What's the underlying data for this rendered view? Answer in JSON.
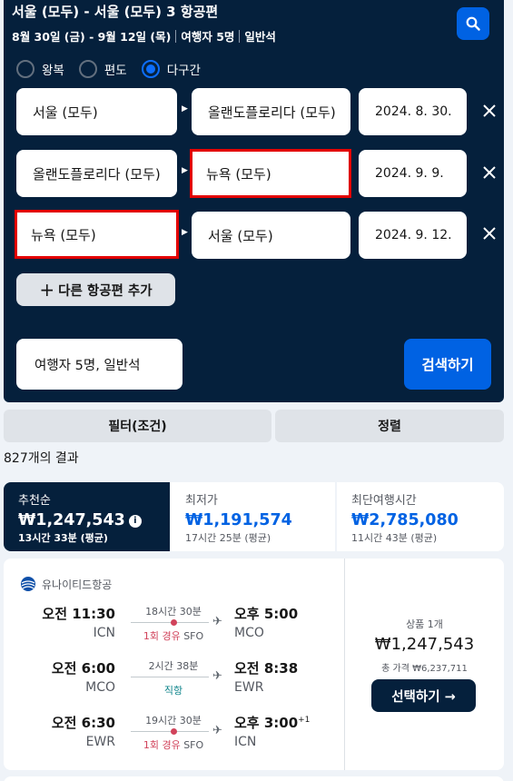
{
  "header": {
    "title": "서울 (모두) - 서울 (모두) 3 항공편",
    "dates": "8월 30일 (금) - 9월 12일 (목)",
    "travelers": "여행자 5명",
    "cabin": "일반석"
  },
  "trip_types": [
    {
      "label": "왕복",
      "selected": false
    },
    {
      "label": "편도",
      "selected": false
    },
    {
      "label": "다구간",
      "selected": true
    }
  ],
  "legs": [
    {
      "from": "서울 (모두)",
      "to": "올랜도플로리다 (모두)",
      "date": "2024. 8. 30."
    },
    {
      "from": "올랜도플로리다 (모두)",
      "to": "뉴욕 (모두)",
      "date": "2024. 9. 9."
    },
    {
      "from": "뉴욕 (모두)",
      "to": "서울 (모두)",
      "date": "2024. 9. 12."
    }
  ],
  "add_flight_label": "다른 항공편 추가",
  "travelers_field": "여행자 5명, 일반석",
  "search_label": "검색하기",
  "filter_label": "필터(조건)",
  "sort_label": "정렬",
  "result_count": "827개의 결과",
  "sort_tabs": [
    {
      "label": "추천순",
      "price": "₩1,247,543",
      "duration": "13시간 33분 (평균)"
    },
    {
      "label": "최저가",
      "price": "₩1,191,574",
      "duration": "17시간 25분 (평균)"
    },
    {
      "label": "최단여행시간",
      "price": "₩2,785,080",
      "duration": "11시간 43분 (평균)"
    }
  ],
  "result": {
    "airline": "유나이티드항공",
    "legs": [
      {
        "dep_time": "오전 11:30",
        "dep_code": "ICN",
        "duration": "18시간 30분",
        "stops": "1회 경유",
        "via": "SFO",
        "arr_time": "오후 5:00",
        "arr_offset": "",
        "arr_code": "MCO"
      },
      {
        "dep_time": "오전 6:00",
        "dep_code": "MCO",
        "duration": "2시간 38분",
        "stops": "직항",
        "via": "",
        "arr_time": "오전 8:38",
        "arr_offset": "",
        "arr_code": "EWR"
      },
      {
        "dep_time": "오전 6:30",
        "dep_code": "EWR",
        "duration": "19시간 30분",
        "stops": "1회 경유",
        "via": "SFO",
        "arr_time": "오후 3:00",
        "arr_offset": "+1",
        "arr_code": "ICN"
      }
    ],
    "deals": "상품 1개",
    "price": "₩1,247,543",
    "total_label": "총 가격 ₩6,237,711",
    "select_label": "선택하기 →"
  },
  "colors": {
    "header_bg": "#05203c",
    "accent": "#0062e3",
    "stop_red": "#d1435b",
    "highlight": "#e30000"
  }
}
